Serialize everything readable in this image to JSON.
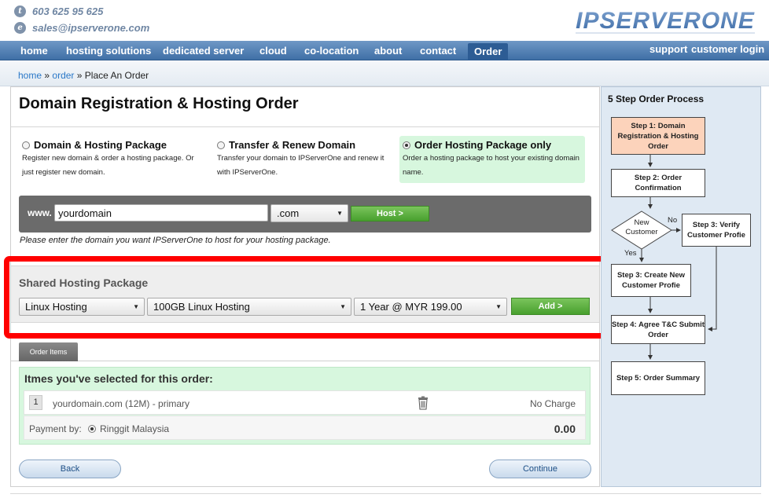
{
  "header": {
    "phone": "603 625 95 625",
    "email": "sales@ipserverone.com",
    "phone_icon": "t",
    "email_icon": "e",
    "logo_text": "IPSERVERONE"
  },
  "nav": {
    "items": [
      "home",
      "hosting solutions",
      "dedicated server",
      "cloud",
      "co-location",
      "about",
      "contact",
      "Order"
    ],
    "support": "support",
    "customer_login": "customer login"
  },
  "breadcrumb": {
    "home": "home",
    "sep1": "»",
    "order": "order",
    "sep2": "»",
    "current": "Place An Order"
  },
  "page_title": "Domain Registration & Hosting Order",
  "options": [
    {
      "title": "Domain & Hosting Package",
      "desc": "Register new domain & order a hosting package. Or just register new domain.",
      "selected": false
    },
    {
      "title": "Transfer & Renew Domain",
      "desc": "Transfer your domain to IPServerOne and renew it with IPServerOne.",
      "selected": false
    },
    {
      "title": "Order Hosting Package only",
      "desc": "Order a hosting package to host your existing domain name.",
      "selected": true
    }
  ],
  "domain": {
    "www_label": "www.",
    "value": "yourdomain",
    "tld": ".com",
    "host_button": "Host >",
    "note": "Please enter the domain you want IPServerOne to host for your hosting package."
  },
  "shared_hosting": {
    "title": "Shared Hosting Package",
    "type": "Linux Hosting",
    "plan": "100GB Linux Hosting",
    "term": "1 Year @ MYR 199.00",
    "add_button": "Add >"
  },
  "order_items": {
    "tab_label": "Order Items",
    "title": "Itmes you've selected for this order:",
    "items": [
      {
        "num": "1",
        "name": "yourdomain.com (12M) - primary",
        "price": "No Charge"
      }
    ],
    "payment_label": "Payment by:",
    "payment_method": "Ringgit Malaysia",
    "total": "0.00"
  },
  "buttons": {
    "back": "Back",
    "continue": "Continue"
  },
  "process": {
    "title": "5 Step Order Process",
    "step1": "Step 1: Domain Registration & Hosting Order",
    "step2": "Step 2: Order Confirmation",
    "decision": "New Customer",
    "no_label": "No",
    "yes_label": "Yes",
    "step3a": "Step 3: Verify Customer Profie",
    "step3b": "Step 3: Create New Customer Profie",
    "step4": "Step 4: Agree T&C Submit Order",
    "step5": "Step 5: Order Summary"
  },
  "colors": {
    "nav": "#4a7ab3",
    "accent_green": "#5cb23f",
    "selected_bg": "#d7f7de",
    "highlight": "#ff0000",
    "current_step": "#fcd3bb"
  }
}
